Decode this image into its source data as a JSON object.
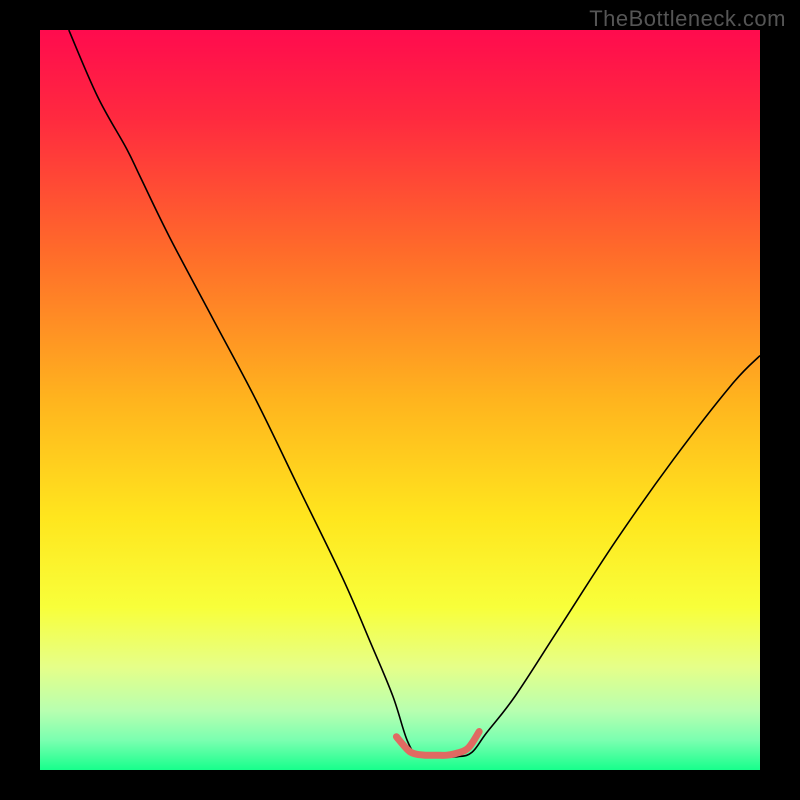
{
  "watermark": "TheBottleneck.com",
  "chart_data": {
    "type": "line",
    "title": "",
    "xlabel": "",
    "ylabel": "",
    "xlim": [
      0,
      100
    ],
    "ylim": [
      0,
      100
    ],
    "legend": false,
    "grid": false,
    "background_gradient_stops": [
      {
        "offset": 0.0,
        "color": "#ff0b4e"
      },
      {
        "offset": 0.12,
        "color": "#ff2a3f"
      },
      {
        "offset": 0.3,
        "color": "#ff6b2a"
      },
      {
        "offset": 0.5,
        "color": "#ffb41e"
      },
      {
        "offset": 0.66,
        "color": "#ffe61e"
      },
      {
        "offset": 0.78,
        "color": "#f8ff3a"
      },
      {
        "offset": 0.86,
        "color": "#e6ff88"
      },
      {
        "offset": 0.92,
        "color": "#b8ffb0"
      },
      {
        "offset": 0.96,
        "color": "#7affb0"
      },
      {
        "offset": 1.0,
        "color": "#17ff8c"
      }
    ],
    "series": [
      {
        "name": "bottleneck-curve",
        "stroke": "#000000",
        "stroke_width": 1.6,
        "x": [
          4,
          8,
          12,
          14,
          18,
          24,
          30,
          36,
          42,
          46,
          49,
          51,
          52.5,
          55,
          58,
          60,
          62,
          66,
          72,
          80,
          88,
          96,
          100
        ],
        "y": [
          100,
          91,
          84,
          80,
          72,
          61,
          50,
          38,
          26,
          17,
          10,
          4,
          2,
          1.8,
          1.8,
          2.4,
          5,
          10,
          19,
          31,
          42,
          52,
          56
        ]
      },
      {
        "name": "optimal-band-marker",
        "stroke": "#e06a62",
        "stroke_width": 7,
        "linecap": "round",
        "x": [
          49.5,
          51,
          52,
          53.5,
          55,
          56.5,
          58,
          59.5,
          61
        ],
        "y": [
          4.5,
          2.8,
          2.2,
          2.0,
          2.0,
          2.0,
          2.3,
          3.0,
          5.2
        ]
      }
    ],
    "annotations": []
  }
}
